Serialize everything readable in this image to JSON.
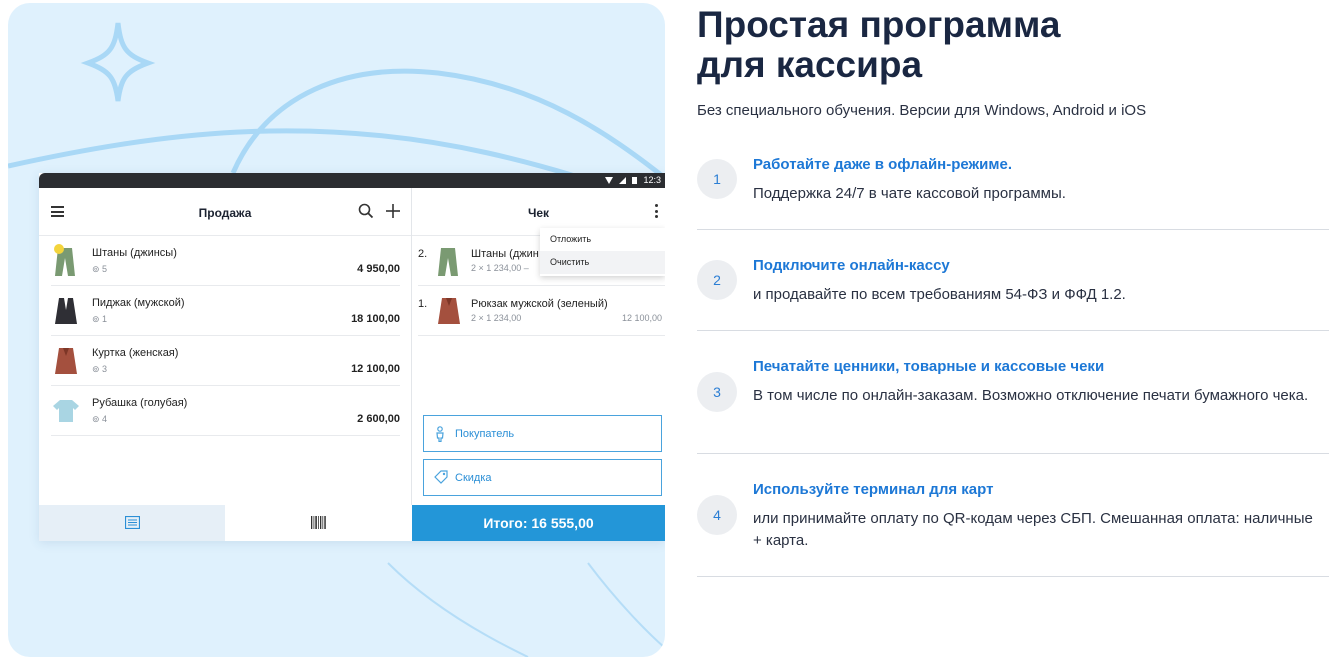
{
  "heading": {
    "line1": "Простая программа",
    "line2": "для кассира",
    "subtitle": "Без специального обучения. Версии для Windows, Android и iOS"
  },
  "features": [
    {
      "num": "1",
      "title": "Работайте даже в офлайн-режиме.",
      "desc": "Поддержка 24/7 в чате кассовой программы."
    },
    {
      "num": "2",
      "title": "Подключите онлайн-кассу",
      "desc": "и продавайте по всем требованиям 54-ФЗ и ФФД 1.2."
    },
    {
      "num": "3",
      "title": "Печатайте ценники, товарные и кассовые чеки",
      "desc": "В том числе по онлайн-заказам. Возможно отключение печати бумажного чека."
    },
    {
      "num": "4",
      "title": "Используйте терминал для карт",
      "desc": "или принимайте оплату по QR-кодам через СБП.  Смешанная оплата: наличные + карта."
    }
  ],
  "app": {
    "status_time": "12:3",
    "sale": {
      "title": "Продажа",
      "products": [
        {
          "name": "Штаны (джинсы)",
          "stock": "5",
          "price": "4 950,00",
          "icon": "pants-icon"
        },
        {
          "name": "Пиджак (мужской)",
          "stock": "1",
          "price": "18 100,00",
          "icon": "jacket-icon"
        },
        {
          "name": "Куртка (женская)",
          "stock": "3",
          "price": "12 100,00",
          "icon": "leather-jacket-icon"
        },
        {
          "name": "Рубашка (голубая)",
          "stock": "4",
          "price": "2 600,00",
          "icon": "shirt-icon"
        }
      ]
    },
    "receipt": {
      "title": "Чек",
      "items": [
        {
          "num": "2.",
          "name": "Штаны (джин",
          "qty": "2 × 1 234,00 –",
          "price": "",
          "icon": "pants-icon"
        },
        {
          "num": "1.",
          "name": "Рюкзак мужской (зеленый)",
          "qty": "2 × 1 234,00",
          "price": "12 100,00",
          "icon": "leather-jacket-icon"
        }
      ],
      "menu": [
        "Отложить",
        "Очистить"
      ],
      "customer_label": "Покупатель",
      "discount_label": "Скидка",
      "total_label": "Итого: 16 555,00"
    }
  },
  "colors": {
    "accent": "#2396d8",
    "link": "#1d78d6",
    "hero_bg": "#dff1fd",
    "heading": "#1a2742"
  }
}
